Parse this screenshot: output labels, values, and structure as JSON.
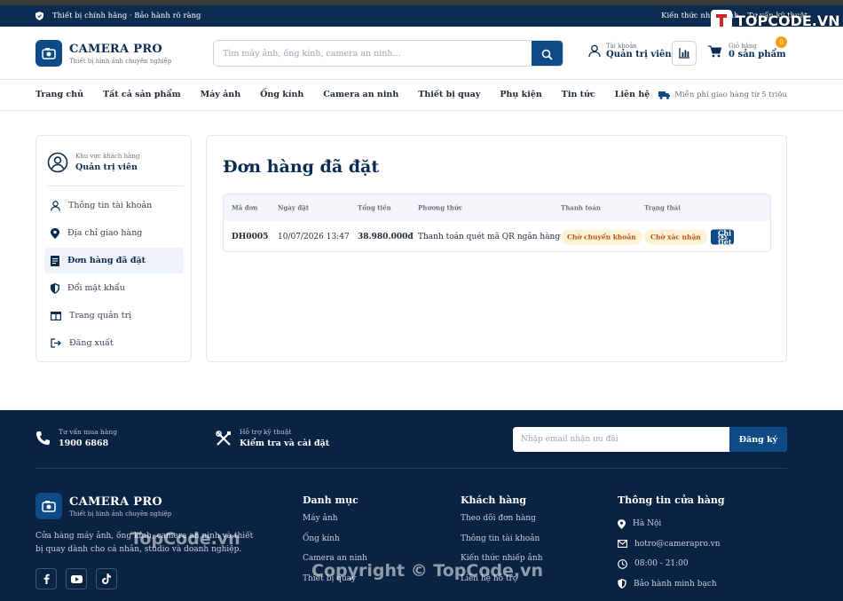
{
  "topbar": {
    "left_text": "Thiết bị chính hãng · Bảo hành rõ ràng",
    "links": [
      "Kiến thức nhiếp ảnh",
      "Tư vấn kỹ thuật"
    ]
  },
  "brand": {
    "name": "CAMERA PRO",
    "tagline": "Thiết bị hình ảnh chuyên nghiệp"
  },
  "search": {
    "placeholder": "Tìm máy ảnh, ống kính, camera an ninh..."
  },
  "account": {
    "label": "Tài khoản",
    "name": "Quản trị viên"
  },
  "cart": {
    "label": "Giỏ hàng",
    "summary": "0 sản phẩm",
    "count": "0"
  },
  "nav": {
    "items": [
      "Trang chủ",
      "Tất cả sản phẩm",
      "Máy ảnh",
      "Ống kính",
      "Camera an ninh",
      "Thiết bị quay",
      "Phụ kiện",
      "Tin tức",
      "Liên hệ"
    ],
    "shipping": "Miễn phí giao hàng từ 5 triệu"
  },
  "sidebar": {
    "area_label": "Khu vực khách hàng",
    "user_name": "Quản trị viên",
    "items": [
      {
        "label": "Thông tin tài khoản",
        "icon": "user-icon"
      },
      {
        "label": "Địa chỉ giao hàng",
        "icon": "map-pin-icon"
      },
      {
        "label": "Đơn hàng đã đặt",
        "icon": "receipt-icon",
        "active": true
      },
      {
        "label": "Đổi mật khẩu",
        "icon": "shield-icon"
      },
      {
        "label": "Trang quản trị",
        "icon": "dashboard-icon"
      },
      {
        "label": "Đăng xuất",
        "icon": "logout-icon"
      }
    ]
  },
  "orders": {
    "title": "Đơn hàng đã đặt",
    "columns": [
      "Mã đơn",
      "Ngày đặt",
      "Tổng tiền",
      "Phương thức",
      "Thanh toán",
      "Trạng thái"
    ],
    "rows": [
      {
        "id": "DH0005",
        "date": "10/07/2026 13:47",
        "total": "38.980.000đ",
        "method": "Thanh toán quét mã QR ngân hàng",
        "payment": "Chờ chuyển khoản",
        "status": "Chờ xác nhận",
        "action": "Chi tiết"
      }
    ]
  },
  "footer": {
    "support": [
      {
        "label": "Tư vấn mua hàng",
        "value": "1900 6868",
        "icon": "phone-icon"
      },
      {
        "label": "Hỗ trợ kỹ thuật",
        "value": "Kiểm tra và cài đặt",
        "icon": "tools-icon"
      }
    ],
    "newsletter": {
      "placeholder": "Nhập email nhận ưu đãi",
      "button": "Đăng ký"
    },
    "about": "Cửa hàng máy ảnh, ống kính, camera an ninh và thiết bị quay dành cho cá nhân, studio và doanh nghiệp.",
    "columns": [
      {
        "title": "Danh mục",
        "links": [
          "Máy ảnh",
          "Ống kính",
          "Camera an ninh",
          "Thiết bị quay"
        ]
      },
      {
        "title": "Khách hàng",
        "links": [
          "Theo dõi đơn hàng",
          "Thông tin tài khoản",
          "Kiến thức nhiếp ảnh",
          "Liên hệ hỗ trợ"
        ]
      }
    ],
    "store": {
      "title": "Thông tin cửa hàng",
      "items": [
        {
          "text": "Hà Nội",
          "icon": "location-icon"
        },
        {
          "text": "hotro@camerapro.vn",
          "icon": "mail-icon"
        },
        {
          "text": "08:00 - 21:00",
          "icon": "clock-icon"
        },
        {
          "text": "Bảo hành minh bạch",
          "icon": "shield-icon"
        }
      ]
    },
    "social": [
      "facebook-icon",
      "youtube-icon",
      "tiktok-icon"
    ]
  },
  "watermarks": {
    "brand": "TOPCODE.VN",
    "mid": "TopCode.vn",
    "copyright": "Copyright © TopCode.vn"
  }
}
